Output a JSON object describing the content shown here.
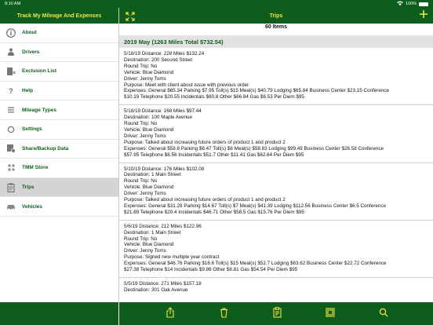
{
  "status_bar": {
    "time": "8:10 AM",
    "battery": "100%"
  },
  "sidebar": {
    "title": "Track My Mileage And Expenses",
    "items": [
      {
        "label": "About",
        "icon": "info-icon"
      },
      {
        "label": "Drivers",
        "icon": "driver-icon"
      },
      {
        "label": "Exclusion List",
        "icon": "exclusion-list-icon"
      },
      {
        "label": "Help",
        "icon": "help-icon"
      },
      {
        "label": "Mileage Types",
        "icon": "mileage-types-icon"
      },
      {
        "label": "Settings",
        "icon": "settings-icon"
      },
      {
        "label": "Share/Backup Data",
        "icon": "share-backup-icon"
      },
      {
        "label": "TMM Store",
        "icon": "store-icon"
      },
      {
        "label": "Trips",
        "icon": "trips-icon",
        "active": true
      },
      {
        "label": "Vehicles",
        "icon": "vehicle-icon"
      }
    ]
  },
  "main": {
    "title": "Trips",
    "count": "60 Items",
    "section": "2019 May (1263 Miles Total $732.54)",
    "trips": [
      {
        "summary": "5/18/19 Distance: 228 Miles $132.24",
        "destination": "Destination: 200 Second Street",
        "round_trip": "Round Trip: No",
        "vehicle": "Vehicle: Blue Diamond",
        "driver": "Driver: Jenny Toms",
        "purpose": "Purpose: Meet with client about issue with previous order",
        "expenses_1": "Expenses: General $65.34 Parking $7.95 Toll(s) $15 Meal(s) $40.79 Lodging $65.84 Business Center $23.15 Conference",
        "expenses_2": "$10.19 Telephone $20.55 Incidentals $60.8 Other $66.84 Gas $8.53 Per Diem $95"
      },
      {
        "summary": "5/18/19 Distance: 168 Miles $97.44",
        "destination": "Destination: 100 Maple Avenue",
        "round_trip": "Round Trip: No",
        "vehicle": "Vehicle: Blue Diamond",
        "driver": "Driver: Jenny Toms",
        "purpose": "Purpose: Talked about increasing future orders of product 1  and product 2",
        "expenses_1": "Expenses: General $58.8 Parking $8.47 Toll(s) $8 Meal(s) $58.83 Lodging $99.49 Business Center $26.58 Conference",
        "expenses_2": "$57.95 Telephone $8.56 Incidentals $51.7 Other $11.41 Gas $62.64 Per Diem $95"
      },
      {
        "summary": "5/10/19 Distance: 176 Miles $102.08",
        "destination": "Destination: 1 Main Street",
        "round_trip": "Round Trip: No",
        "vehicle": "Vehicle: Blue Diamond",
        "driver": "Driver: Jenny Toms",
        "purpose": "Purpose: Talked about increasing future orders of product 1  and product 2",
        "expenses_1": "Expenses: General $31.28 Parking $14.67 Toll(s) $7 Meal(s) $41.39 Lodging $112.56 Business Center $6.5 Conference",
        "expenses_2": "$21.69 Telephone $20.4 Incidentals $46.71 Other $58.5 Gas $15.76 Per Diem $95"
      },
      {
        "summary": "5/6/19 Distance: 212 Miles $122.96",
        "destination": "Destination: 1 Main Street",
        "round_trip": "Round Trip: No",
        "vehicle": "Vehicle: Blue Diamond",
        "driver": "Driver: Jenny Toms",
        "purpose": "Purpose: Signed new multiple year contract",
        "expenses_1": "Expenses: General $46.76 Parking $16.6 Toll(s) $15 Meal(s) $52.7 Lodging $63.62 Business Center $22.72 Conference",
        "expenses_2": "$27.38 Telephone $14 Incidentals $9.86 Other $8.81 Gas $54.54 Per Diem $95"
      },
      {
        "summary": "5/5/19 Distance: 271 Miles $157.18",
        "destination": "Destination: 301 Oak Avenue",
        "round_trip": "",
        "vehicle": "",
        "driver": "",
        "purpose": "",
        "expenses_1": "",
        "expenses_2": ""
      }
    ]
  },
  "toolbar": {
    "buttons": [
      {
        "icon": "share-icon"
      },
      {
        "icon": "trash-icon"
      },
      {
        "icon": "clipboard-icon"
      },
      {
        "icon": "report-icon"
      },
      {
        "icon": "search-icon"
      }
    ]
  },
  "colors": {
    "header_bg": "#0d5e1c",
    "header_text": "#f0e442",
    "accent": "#0d5e1c"
  }
}
